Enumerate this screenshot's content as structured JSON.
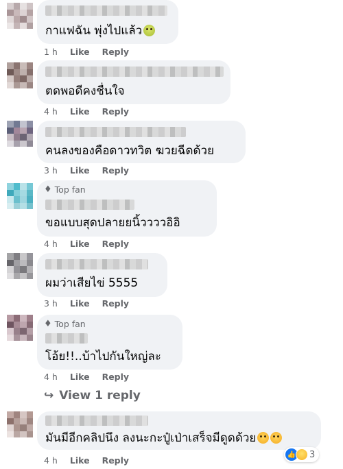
{
  "comments": [
    {
      "top_fan": "",
      "text": "กาแฟฉัน พุ่งไปแล้ว",
      "has_emoji": true,
      "time": "1 h",
      "like": "Like",
      "reply": "Reply"
    },
    {
      "top_fan": "",
      "text": "ตดพอดีคงชื่นใจ",
      "time": "4 h",
      "like": "Like",
      "reply": "Reply"
    },
    {
      "top_fan": "",
      "text": "คนลงของคือดาวทวิต ฆวยฉีดด้วย",
      "time": "3 h",
      "like": "Like",
      "reply": "Reply"
    },
    {
      "top_fan": "Top fan",
      "text": "ขอแบบสุดปลายยนิ้ววววอิอิ",
      "time": "4 h",
      "like": "Like",
      "reply": "Reply"
    },
    {
      "top_fan": "",
      "text": "ผมว่าเสียไข่ 5555",
      "time": "3 h",
      "like": "Like",
      "reply": "Reply"
    },
    {
      "top_fan": "Top fan",
      "text": "โอ้ย!!..บ้าไปกันใหญ่ละ",
      "time": "4 h",
      "like": "Like",
      "reply": "Reply"
    },
    {
      "top_fan": "",
      "text": "มันมีอีกคลิปนึง ลงนะกะปู๋เป่าเสร็จมีดูดด้วย",
      "has_emoji": true,
      "time": "4 h",
      "like": "Like",
      "reply": "Reply"
    }
  ],
  "view_replies": "View 1 reply",
  "reaction_count": "3",
  "colors": {
    "bubble": "#f0f2f5",
    "meta": "#65676b",
    "like_blue": "#1877f2"
  }
}
